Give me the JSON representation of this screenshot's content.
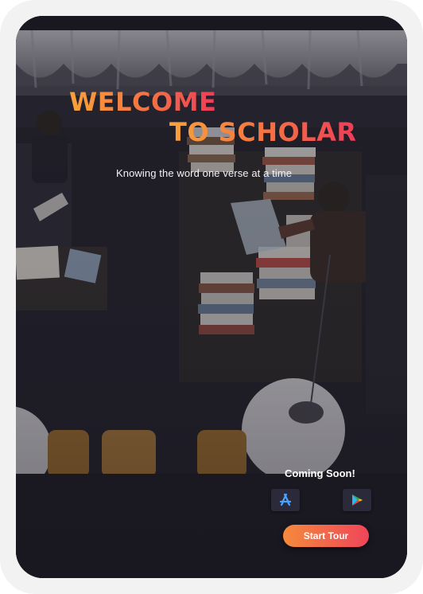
{
  "hero": {
    "title_line1": "WELCOME",
    "title_line2": "TO SCHOLAR",
    "tagline": "Knowing the word one verse at a time"
  },
  "download": {
    "coming_soon": "Coming Soon!",
    "stores": [
      {
        "icon": "app-store-icon",
        "color": "#4aa3ff"
      },
      {
        "icon": "google-play-icon",
        "color": "#34a853"
      }
    ]
  },
  "cta": {
    "start_tour": "Start Tour"
  },
  "colors": {
    "title_gradient_start": "#f9a23a",
    "title_gradient_end": "#ee3c5a",
    "button_gradient_start": "#f58a3c",
    "button_gradient_end": "#f0455a",
    "background": "#1d1b24"
  }
}
